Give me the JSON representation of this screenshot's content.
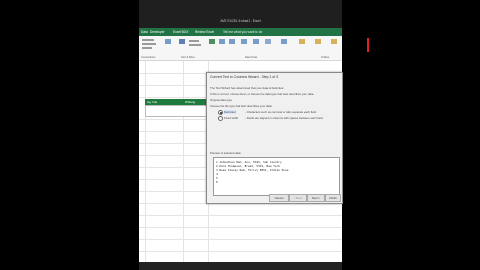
{
  "window": {
    "title": "AVE EXCEL 6 nbsd1 - Excel"
  },
  "ribbon": {
    "tabs": [
      "Data",
      "Developer",
      "Excel BOX",
      "Review Excel"
    ],
    "tell_me": "Tell me what you want to do",
    "groups": [
      "Connections",
      "Sort & Filter",
      "Data Tools",
      "Outline"
    ]
  },
  "sheet": {
    "header": [
      "Ag. File",
      "Whiang"
    ]
  },
  "dialog": {
    "title": "Convert Text to Columns Wizard - Step 1 of 3",
    "intro1": "The Text Wizard has determined that your data is Delimited.",
    "intro2": "If this is correct, choose Next, or choose the data type that best describes your data.",
    "section": "Original data type",
    "choose": "Choose the file type that best describes your data:",
    "opt_delimited": "Delimited",
    "opt_delimited_desc": "- Characters such as commas or tabs separate each field.",
    "opt_fixed": "Fixed width",
    "opt_fixed_desc": "- Fields are aligned in columns with spaces between each field.",
    "preview_label": "Preview of selected data:",
    "preview_lines": [
      "1 Johnathan Ram, Anu, 5345, Sah Country",
      "2 Dara Thompson, Bread, 5391, New York",
      "3 Rose Stacey Ram, Thrivy 8051, Indian Pune",
      "4",
      "5",
      "6"
    ],
    "buttons": {
      "cancel": "Cancel",
      "back": "< Back",
      "next": "Next >",
      "finish": "Finish"
    }
  }
}
